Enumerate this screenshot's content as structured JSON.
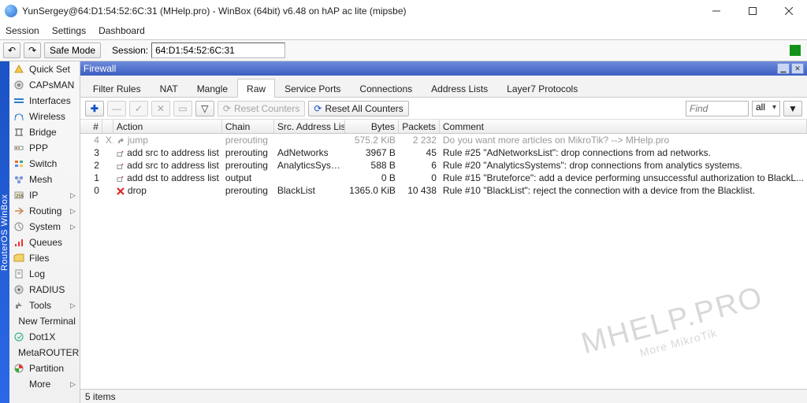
{
  "window": {
    "title": "YunSergey@64:D1:54:52:6C:31 (MHelp.pro) - WinBox (64bit) v6.48 on hAP ac lite (mipsbe)"
  },
  "menubar": [
    "Session",
    "Settings",
    "Dashboard"
  ],
  "toolbar": {
    "safe_mode": "Safe Mode",
    "session_label": "Session:",
    "session_value": "64:D1:54:52:6C:31"
  },
  "vstrip": "RouterOS WinBox",
  "sidebar": {
    "items": [
      {
        "label": "Quick Set",
        "arrow": false
      },
      {
        "label": "CAPsMAN",
        "arrow": false
      },
      {
        "label": "Interfaces",
        "arrow": false
      },
      {
        "label": "Wireless",
        "arrow": false
      },
      {
        "label": "Bridge",
        "arrow": false
      },
      {
        "label": "PPP",
        "arrow": false
      },
      {
        "label": "Switch",
        "arrow": false
      },
      {
        "label": "Mesh",
        "arrow": false
      },
      {
        "label": "IP",
        "arrow": true
      },
      {
        "label": "Routing",
        "arrow": true
      },
      {
        "label": "System",
        "arrow": true
      },
      {
        "label": "Queues",
        "arrow": false
      },
      {
        "label": "Files",
        "arrow": false
      },
      {
        "label": "Log",
        "arrow": false
      },
      {
        "label": "RADIUS",
        "arrow": false
      },
      {
        "label": "Tools",
        "arrow": true
      },
      {
        "label": "New Terminal",
        "arrow": false
      },
      {
        "label": "Dot1X",
        "arrow": false
      },
      {
        "label": "MetaROUTER",
        "arrow": false
      },
      {
        "label": "Partition",
        "arrow": false
      },
      {
        "label": "More",
        "arrow": true
      }
    ]
  },
  "panel": {
    "title": "Firewall",
    "tabs": [
      "Filter Rules",
      "NAT",
      "Mangle",
      "Raw",
      "Service Ports",
      "Connections",
      "Address Lists",
      "Layer7 Protocols"
    ],
    "active_tab": "Raw",
    "buttons": {
      "reset_counters": "Reset Counters",
      "reset_all_counters": "Reset All Counters"
    },
    "find_placeholder": "Find",
    "filter_value": "all"
  },
  "grid": {
    "columns": [
      "#",
      "",
      "Action",
      "Chain",
      "Src. Address List",
      "Bytes",
      "Packets",
      "Comment"
    ],
    "rows": [
      {
        "idx": "0",
        "flag": "",
        "action": "drop",
        "icon": "x",
        "chain": "prerouting",
        "src": "BlackList",
        "bytes": "1365.0 KiB",
        "packets": "10 438",
        "comment": "Rule #10 \"BlackList\": reject the connection with a device from the Blacklist.",
        "disabled": false
      },
      {
        "idx": "1",
        "flag": "",
        "action": "add dst to address list",
        "icon": "add",
        "chain": "output",
        "src": "",
        "bytes": "0 B",
        "packets": "0",
        "comment": "Rule #15 \"Bruteforce\": add a device performing unsuccessful authorization to BlackL...",
        "disabled": false
      },
      {
        "idx": "2",
        "flag": "",
        "action": "add src to address list",
        "icon": "add",
        "chain": "prerouting",
        "src": "AnalyticsSystems",
        "bytes": "588 B",
        "packets": "6",
        "comment": "Rule #20 \"AnalyticsSystems\": drop connections from analytics systems.",
        "disabled": false
      },
      {
        "idx": "3",
        "flag": "",
        "action": "add src to address list",
        "icon": "add",
        "chain": "prerouting",
        "src": "AdNetworks",
        "bytes": "3967 B",
        "packets": "45",
        "comment": "Rule #25 \"AdNetworksList\": drop connections from ad networks.",
        "disabled": false
      },
      {
        "idx": "4",
        "flag": "X",
        "action": "jump",
        "icon": "jump",
        "chain": "prerouting",
        "src": "",
        "bytes": "575.2 KiB",
        "packets": "2 232",
        "comment": "Do you want more articles on MikroTik? --> MHelp.pro",
        "disabled": true
      }
    ],
    "status": "5 items"
  },
  "watermark": {
    "main": "MHELP.PRO",
    "sub": "More MikroTik"
  },
  "icons": {
    "undo": "↶",
    "redo": "↷",
    "plus": "✚",
    "minus": "—",
    "check": "✓",
    "x": "✕",
    "note": "▭",
    "funnel": "▽",
    "refresh": "⟳"
  },
  "sb_icons": [
    "<svg viewBox='0 0 14 12'><polygon points='2,10 7,1 12,10' fill='#f2c84b' stroke='#c89a21'/></svg>",
    "<svg viewBox='0 0 14 12'><circle cx='7' cy='6' r='5' fill='#d8d8d8' stroke='#888'/><circle cx='7' cy='6' r='2' fill='#888'/></svg>",
    "<svg viewBox='0 0 14 12'><rect x='1' y='3' width='12' height='2' fill='#2f7dd1'/><rect x='1' y='7' width='12' height='2' fill='#2f7dd1'/></svg>",
    "<svg viewBox='0 0 14 12'><path d='M2 11 Q2 3 7 3 Q12 3 12 11' stroke='#2f7dd1' fill='none'/><circle cx='3' cy='5' r='1' fill='#2f7dd1'/><circle cx='11' cy='5' r='1' fill='#2f7dd1'/></svg>",
    "<svg viewBox='0 0 14 12'><path d='M2 2 L12 2 M2 10 L12 10 M4 2 L4 10 M10 2 L10 10' stroke='#444' fill='none'/></svg>",
    "<svg viewBox='0 0 14 12'><rect x='2' y='4' width='10' height='4' fill='#fff' stroke='#888'/><circle cx='4' cy='6' r='1' fill='#e33'/><circle cx='7' cy='6' r='1' fill='#3a3'/></svg>",
    "<svg viewBox='0 0 14 12'><rect x='2' y='2' width='4' height='3' fill='#e86b1f'/><rect x='8' y='2' width='4' height='3' fill='#3a8'/><rect x='2' y='7' width='4' height='3' fill='#58e'/><rect x='8' y='7' width='4' height='3' fill='#ec4'/></svg>",
    "<svg viewBox='0 0 14 12'><circle cx='4' cy='4' r='2' fill='#58e'/><circle cx='10' cy='4' r='2' fill='#58e'/><circle cx='7' cy='9' r='2' fill='#58e'/><path d='M4 4 L10 4 L7 9 Z' stroke='#aaa' fill='none'/></svg>",
    "<svg viewBox='0 0 14 12'><rect x='2' y='2' width='10' height='8' fill='#ecebc6' stroke='#999'/><text x='3' y='9' font-size='6' fill='#333'>255</text></svg>",
    "<svg viewBox='0 0 14 12'><path d='M7 2 L12 6 L7 10 M2 6 L12 6' stroke='#c85' fill='none' stroke-width='1.5'/></svg>",
    "<svg viewBox='0 0 14 12'><circle cx='7' cy='6' r='5' fill='none' stroke='#888'/><path d='M7 6 L7 2 M7 6 L10 8' stroke='#888'/></svg>",
    "<svg viewBox='0 0 14 12'><rect x='2' y='8' width='2' height='3' fill='#e33'/><rect x='6' y='5' width='2' height='6' fill='#e33'/><rect x='10' y='2' width='2' height='9' fill='#e33'/></svg>",
    "<svg viewBox='0 0 14 12'><path d='M1 3 L5 1 L13 1 L13 10 L1 10 Z' fill='#f3d36b' stroke='#c89a21'/></svg>",
    "<svg viewBox='0 0 14 12'><rect x='3' y='1' width='8' height='10' fill='#fff' stroke='#888'/><line x1='5' y1='4' x2='9' y2='4' stroke='#888'/><line x1='5' y1='6' x2='9' y2='6' stroke='#888'/></svg>",
    "<svg viewBox='0 0 14 12'><circle cx='7' cy='6' r='5' fill='#d8d8d8' stroke='#888'/><circle cx='7' cy='6' r='1.5' fill='#555'/></svg>",
    "<svg viewBox='0 0 14 12'><path d='M3 10 L3 5 L6 5 L6 2 L11 7 L6 7 L6 10 Z' fill='#888'/></svg>",
    "<svg viewBox='0 0 14 12'><rect x='2' y='2' width='10' height='8' fill='#111'/><text x='3' y='8' font-size='6' fill='#6f6'>&gt;_</text></svg>",
    "<svg viewBox='0 0 14 12'><circle cx='7' cy='6' r='5' fill='none' stroke='#2a7'/><path d='M5 6 L7 8 L10 4' stroke='#2a7' fill='none'/></svg>",
    "<svg viewBox='0 0 14 12'><rect x='2' y='3' width='10' height='6' fill='#fff' stroke='#888'/><rect x='4' y='5' width='2' height='2' fill='#e33'/><rect x='8' y='5' width='2' height='2' fill='#38e'/></svg>",
    "<svg viewBox='0 0 14 12'><circle cx='7' cy='6' r='5' fill='none' stroke='#888'/><path d='M7 1 A5 5 0 0 1 12 6 L7 6 Z' fill='#e33'/><path d='M7 6 L2 6 A5 5 0 0 0 7 11 Z' fill='#3a3'/></svg>",
    ""
  ]
}
